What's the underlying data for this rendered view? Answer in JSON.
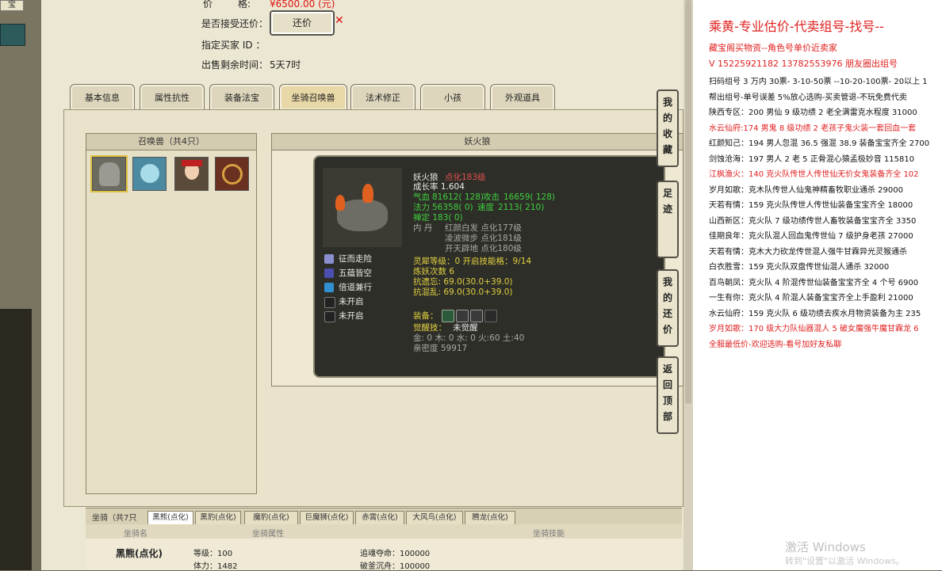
{
  "left_strip": {
    "tab1": "宝"
  },
  "info": {
    "price_label": "价",
    "price_prefix": "格:",
    "price_value": "¥6500.00 (元)",
    "accept_label": "是否接受还价：",
    "accept_button": "还价",
    "buyer_label": "指定买家 ID ：",
    "remain_label": "出售剩余时间：",
    "remain_value": "5天7时"
  },
  "tabs": [
    "基本信息",
    "属性抗性",
    "装备法宝",
    "坐骑召唤兽",
    "法术修正",
    "小孩",
    "外观道具"
  ],
  "pet_panel_title": "召唤兽（共4只）",
  "detail_title": "妖火狼",
  "pet": {
    "name": "妖火狼",
    "level": "点化183级",
    "growth": "成长率 1.604",
    "hp_label": "气血",
    "hp_value": "81612( 128)",
    "atk_label": "攻击",
    "atk_value": "16659( 128)",
    "mp_label": "法力",
    "mp_value": "56358( 0)",
    "spd_label": "速度",
    "spd_value": "2113( 210)",
    "zen": "禅定 183( 0)",
    "neidan_label": "内    丹",
    "neidan1": "红颜白发 点化177级",
    "neidan2": "凌波微步 点化181级",
    "neidan3": "开天辟地 点化180级",
    "skills": [
      "征而走险",
      "五蕴皆空",
      "倍道兼行",
      "未开启",
      "未开启"
    ],
    "lingxi": "灵犀等级：0 开启技能格：9/14",
    "lianyao": "炼妖次数 6",
    "kang1": "抗遗忘: 69.0(30.0+39.0)",
    "kang2": "抗混乱: 69.0(30.0+39.0)",
    "equip_label": "装备：",
    "awaken_label": "觉醒技：",
    "awaken_value": "未觉醒",
    "elements": "金: 0 木: 0 水: 0 火:60 土:40",
    "intimacy": "亲密度 59917"
  },
  "side_buttons": [
    "我的收藏",
    "足迹",
    "我的还价",
    "返回顶部"
  ],
  "mount": {
    "label": "坐骑（共7只",
    "tabs": [
      "黑熊(点化)",
      "黑豹(点化)",
      "魔豹(点化)",
      "巨魔狮(点化)",
      "赤霄(点化)",
      "大风鸟(点化)",
      "腾龙(点化)"
    ],
    "headers": [
      "坐骑名",
      "坐骑属性",
      "坐骑技能"
    ],
    "row_name": "黑熊(点化)",
    "attrs": [
      "等级：100",
      "体力：1482"
    ],
    "skills": [
      "追魂夺命：100000",
      "破釜沉舟：100000"
    ]
  },
  "doc": {
    "title": "乘黄-专业估价-代卖组号-找号--",
    "line1": "藏宝阁买物资--角色号单价近卖家",
    "line2": "V 15225921182   13782553976 朋友圈出组号",
    "lines": [
      {
        "t": "扫码组号 3 万内 30票- 3-10-50票  --10-20-100票- 20以上 1",
        "red": false
      },
      {
        "t": "帮出组号-单号误差 5%放心选购-买卖管退-不玩免费代卖",
        "red": false
      },
      {
        "t": "陕西专区：200 男仙 9 级功绩 2 老全满雷克水程度 31000",
        "red": false
      },
      {
        "t": "水云仙府:174 男鬼 8 级功绩 2 老孩子鬼火装一套回血一套",
        "red": true
      },
      {
        "t": "红颜知己：194 男人忽混 36.5 强混 38.9 装备宝宝齐全 2700",
        "red": false
      },
      {
        "t": "剑蚀沧海：197 男人 2 老 5 正骨混心猿孟极妙音 115810",
        "red": false
      },
      {
        "t": "江枫渔火：140 克火队传世人传世仙无价女鬼装备齐全 102",
        "red": true
      },
      {
        "t": "岁月如歌：克木队传世人仙鬼神精畜牧职业通杀 29000",
        "red": false
      },
      {
        "t": "天若有情：159 克火队传世人传世仙装备宝宝齐全 18000",
        "red": false
      },
      {
        "t": "山西新区：克火队 7 级功绩传世人畜牧装备宝宝齐全 3350",
        "red": false
      },
      {
        "t": "佳期良年：克火队混人回血鬼传世仙 7 级护身老孩 27000",
        "red": false
      },
      {
        "t": "天若有情：克木大力砍龙传世混人强牛甘霖异光灵猴通杀",
        "red": false
      },
      {
        "t": "白衣胜雪：159 克火队双盘传世仙混人通杀 32000",
        "red": false
      },
      {
        "t": "百鸟朝凤：克火队 4 阶混传世仙装备宝宝齐全 4 个号 6900",
        "red": false
      },
      {
        "t": "一生有你：克火队 4 阶混人装备宝宝齐全上手盈利 21000",
        "red": false
      },
      {
        "t": "水云仙府：159 克火队 6 级功绩去疾水月物资装备为主 235",
        "red": false
      },
      {
        "t": "岁月如歌：170 级大力队仙器混人 5 破女魔强牛魔甘霖龙 6",
        "red": true
      },
      {
        "t": "全服最低价-欢迎选购-看号加好友私聊",
        "red": true
      }
    ],
    "watermark1": "激活 Windows",
    "watermark2": "转到\"设置\"以激活 Windows。"
  }
}
